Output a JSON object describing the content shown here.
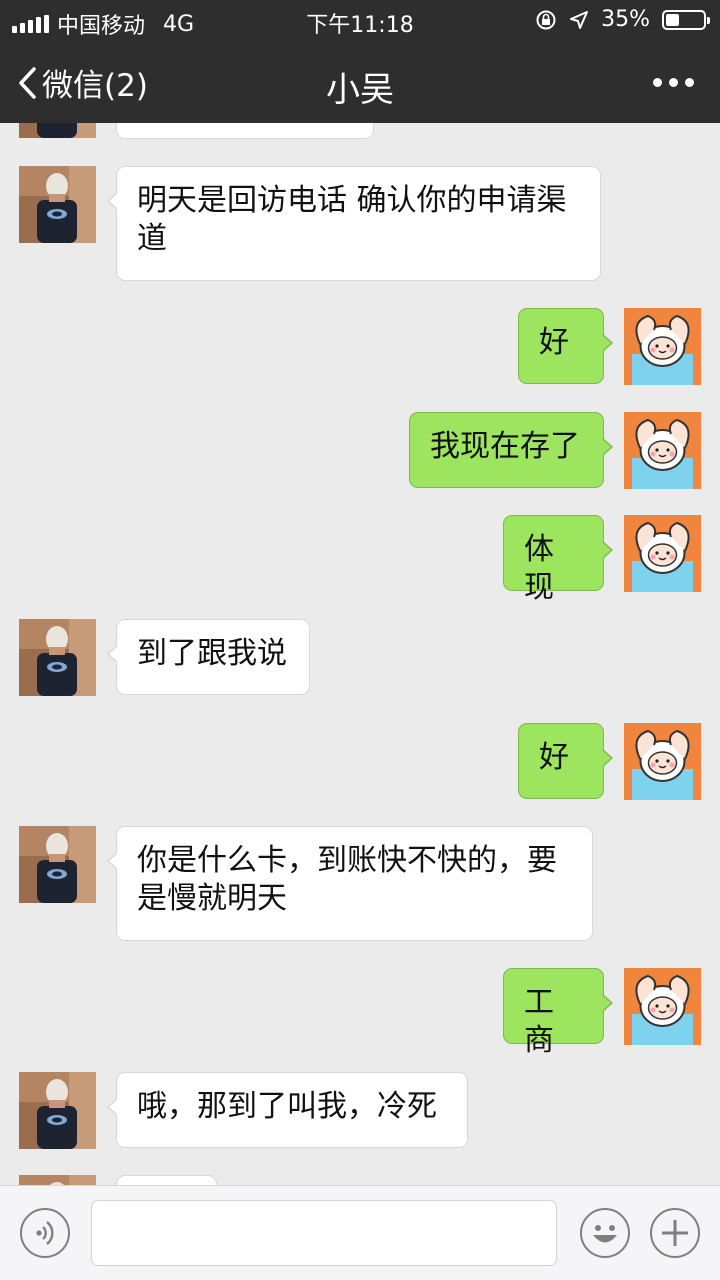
{
  "status_bar": {
    "carrier": "中国移动",
    "network": "4G",
    "time": "下午11:18",
    "battery": "35%",
    "battery_level": 0.35
  },
  "nav": {
    "back_label": "微信(2)",
    "title": "小吴"
  },
  "messages": [
    {
      "side": "in",
      "text": "明天是回访电话 确认你的申请渠道"
    },
    {
      "side": "out",
      "text": "好"
    },
    {
      "side": "out",
      "text": "我现在存了"
    },
    {
      "side": "out",
      "text": "体现"
    },
    {
      "side": "in",
      "text": "到了跟我说"
    },
    {
      "side": "out",
      "text": "好"
    },
    {
      "side": "in",
      "text": "你是什么卡，到账快不快的，要是慢就明天"
    },
    {
      "side": "out",
      "text": "工商"
    },
    {
      "side": "in",
      "text": "哦，那到了叫我，冷死"
    }
  ],
  "input": {
    "placeholder": ""
  },
  "icons": {
    "voice": "voice-icon",
    "emoji": "emoji-icon",
    "plus": "plus-icon",
    "back": "chevron-left-icon",
    "more": "more-dots-icon"
  },
  "colors": {
    "header": "#2e2e2e",
    "background": "#ebebeb",
    "outgoing_bubble": "#9de45f",
    "incoming_bubble": "#ffffff"
  }
}
